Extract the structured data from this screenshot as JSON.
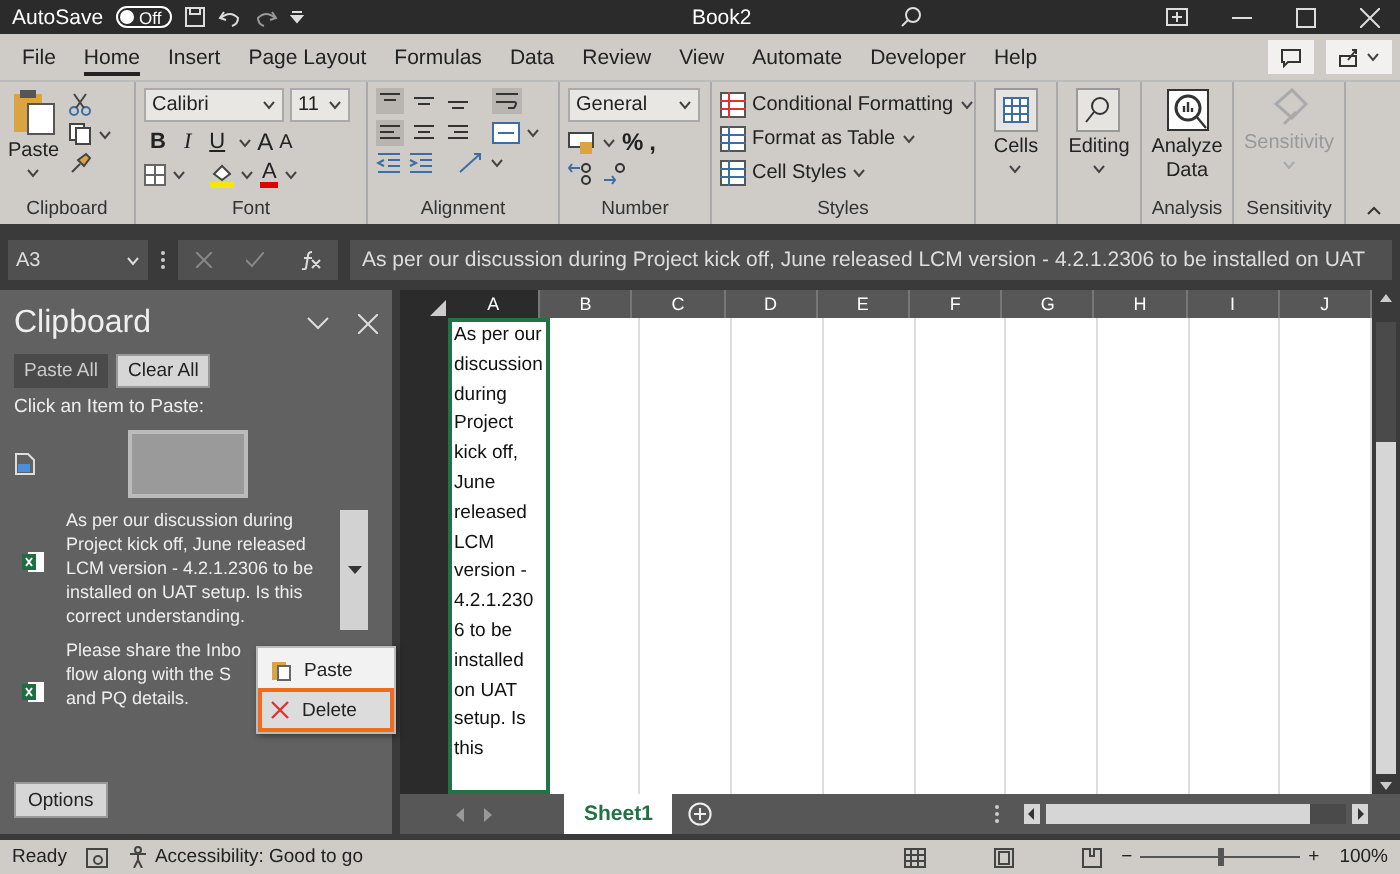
{
  "title_bar": {
    "autosave_label": "AutoSave",
    "autosave": {
      "on": false,
      "label": "Off"
    },
    "title": "Book2"
  },
  "tabs": [
    {
      "label": "File",
      "selected": false
    },
    {
      "label": "Home",
      "selected": true
    },
    {
      "label": "Insert",
      "selected": false
    },
    {
      "label": "Page Layout",
      "selected": false
    },
    {
      "label": "Formulas",
      "selected": false
    },
    {
      "label": "Data",
      "selected": false
    },
    {
      "label": "Review",
      "selected": false
    },
    {
      "label": "View",
      "selected": false
    },
    {
      "label": "Automate",
      "selected": false
    },
    {
      "label": "Developer",
      "selected": false
    },
    {
      "label": "Help",
      "selected": false
    }
  ],
  "ribbon": {
    "clipboard": {
      "paste": "Paste",
      "label": "Clipboard"
    },
    "font": {
      "name": "Calibri",
      "size": "11",
      "style_buttons": [
        "B",
        "I",
        "U"
      ],
      "size_buttons": [
        "A",
        "A"
      ],
      "font_color_button": "A",
      "label": "Font"
    },
    "alignment": {
      "label": "Alignment"
    },
    "number": {
      "format": "General",
      "buttons": [
        "%",
        ","
      ],
      "label": "Number"
    },
    "styles": {
      "items": [
        "Conditional Formatting",
        "Format as Table",
        "Cell Styles"
      ],
      "label": "Styles"
    },
    "cells": {
      "button": "Cells"
    },
    "editing": {
      "button": "Editing"
    },
    "analysis": {
      "button": "Analyze Data",
      "label": "Analysis"
    },
    "sensitivity": {
      "button": "Sensitivity",
      "disabled": true,
      "label": "Sensitivity"
    }
  },
  "formula_bar": {
    "name_box": "A3",
    "content": "As per our discussion during Project kick off, June released LCM version - 4.2.1.2306 to be installed on UAT"
  },
  "clipboard_pane": {
    "title": "Clipboard",
    "paste_all": "Paste All",
    "clear_all": "Clear All",
    "hint": "Click an Item to Paste:",
    "items": [
      {
        "kind": "image",
        "selected": false
      },
      {
        "kind": "text",
        "selected": true,
        "lines": [
          "As per our discussion during",
          "Project kick off, June released",
          "LCM version - 4.2.1.2306 to be",
          "installed on UAT setup. Is this",
          "correct understanding."
        ]
      },
      {
        "kind": "text",
        "selected": false,
        "lines": [
          "Please share the Inbo",
          "flow along with the S",
          "and PQ details."
        ]
      }
    ],
    "options": "Options"
  },
  "context_menu": {
    "items": [
      {
        "label": "Paste",
        "selected": false
      },
      {
        "label": "Delete",
        "selected": true
      }
    ]
  },
  "sheet": {
    "columns": [
      {
        "label": "A",
        "selected": true
      },
      {
        "label": "B",
        "selected": false
      },
      {
        "label": "C",
        "selected": false
      },
      {
        "label": "D",
        "selected": false
      },
      {
        "label": "E",
        "selected": false
      },
      {
        "label": "F",
        "selected": false
      },
      {
        "label": "G",
        "selected": false
      },
      {
        "label": "H",
        "selected": false
      },
      {
        "label": "I",
        "selected": false
      },
      {
        "label": "J",
        "selected": false
      }
    ],
    "cell": "As per our discussion during Project kick off, June released LCM version - 4.2.1.2306 to be installed on UAT setup. Is this"
  },
  "sheet_tabs": [
    {
      "label": "Sheet1",
      "selected": true
    }
  ],
  "status_bar": {
    "status": "Ready",
    "accessibility": "Accessibility: Good to go",
    "zoom": {
      "minus": "−",
      "plus": "+",
      "level": 0.5,
      "reading": "100%"
    }
  }
}
